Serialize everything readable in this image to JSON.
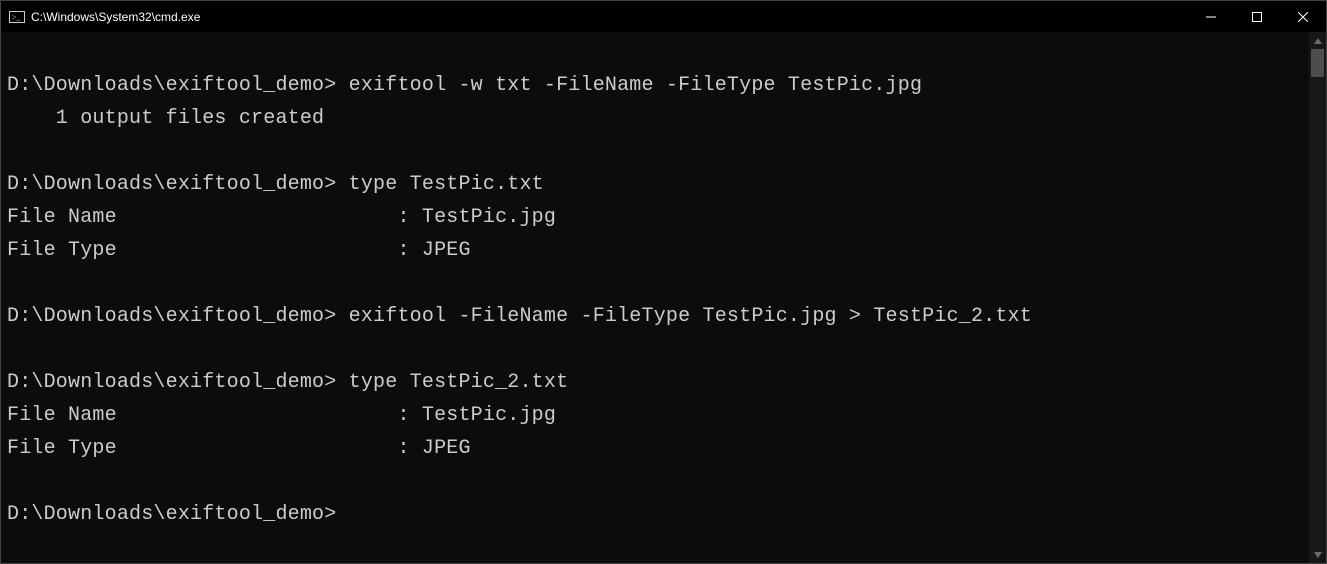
{
  "window": {
    "title": "C:\\Windows\\System32\\cmd.exe"
  },
  "terminal": {
    "lines": [
      "",
      "D:\\Downloads\\exiftool_demo> exiftool -w txt -FileName -FileType TestPic.jpg",
      "    1 output files created",
      "",
      "D:\\Downloads\\exiftool_demo> type TestPic.txt",
      "File Name                       : TestPic.jpg",
      "File Type                       : JPEG",
      "",
      "D:\\Downloads\\exiftool_demo> exiftool -FileName -FileType TestPic.jpg > TestPic_2.txt",
      "",
      "D:\\Downloads\\exiftool_demo> type TestPic_2.txt",
      "File Name                       : TestPic.jpg",
      "File Type                       : JPEG",
      "",
      "D:\\Downloads\\exiftool_demo>"
    ]
  }
}
